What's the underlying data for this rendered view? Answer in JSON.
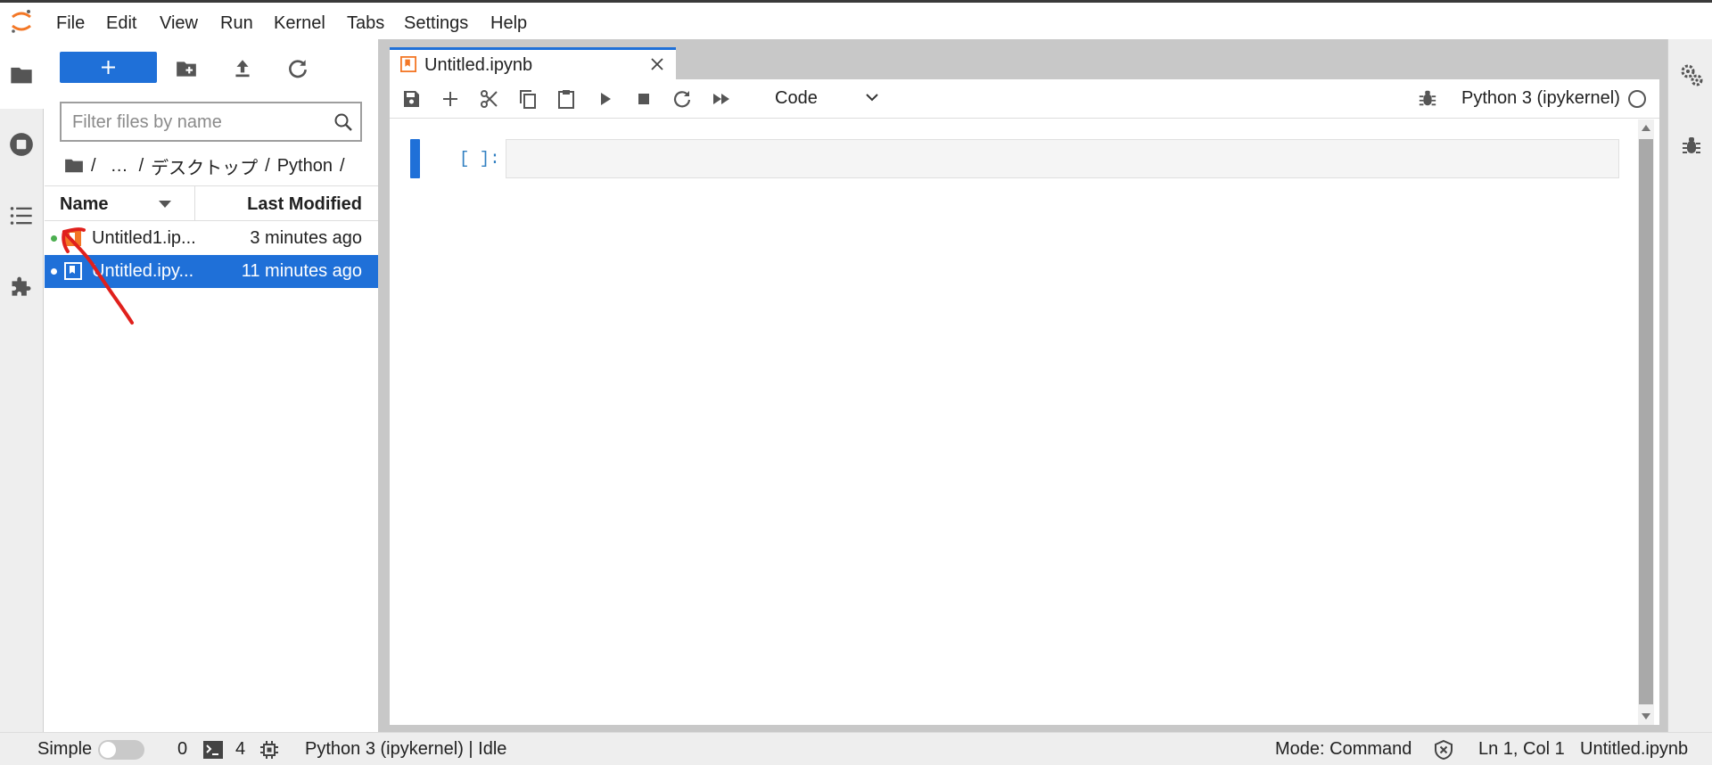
{
  "menubar": {
    "items": [
      "File",
      "Edit",
      "View",
      "Run",
      "Kernel",
      "Tabs",
      "Settings",
      "Help"
    ]
  },
  "left_sidebar": {
    "tabs": [
      "file-browser",
      "running-terminals-kernels",
      "table-of-contents",
      "extension-manager"
    ]
  },
  "file_browser": {
    "new_button_icon": "plus-icon",
    "filter_placeholder": "Filter files by name",
    "breadcrumb": {
      "ellipsis": "…",
      "segments": [
        "デスクトップ",
        "Python"
      ],
      "separator": "/"
    },
    "columns": {
      "name": "Name",
      "modified": "Last Modified"
    },
    "files": [
      {
        "name": "Untitled1.ipynb",
        "display_name": "Untitled1.ip...",
        "modified": "3 minutes ago",
        "running": true,
        "selected": false
      },
      {
        "name": "Untitled.ipynb",
        "display_name": "Untitled.ipy...",
        "modified": "11 minutes ago",
        "running": true,
        "selected": true
      }
    ]
  },
  "editor": {
    "tab_label": "Untitled.ipynb",
    "cell_type": "Code",
    "kernel_name": "Python 3 (ipykernel)",
    "cell_prompt": "[ ]:"
  },
  "statusbar": {
    "simple_label": "Simple",
    "simple_enabled": false,
    "kernels_count": "0",
    "terminals_count": "4",
    "kernel_status": "Python 3 (ipykernel) | Idle",
    "mode": "Mode: Command",
    "cursor": "Ln 1, Col 1",
    "file": "Untitled.ipynb"
  },
  "colors": {
    "accent": "#1f70d8",
    "notebook_icon": "#f37726",
    "running_dot_green": "#4caf50",
    "annotation_red": "#e0201c"
  }
}
